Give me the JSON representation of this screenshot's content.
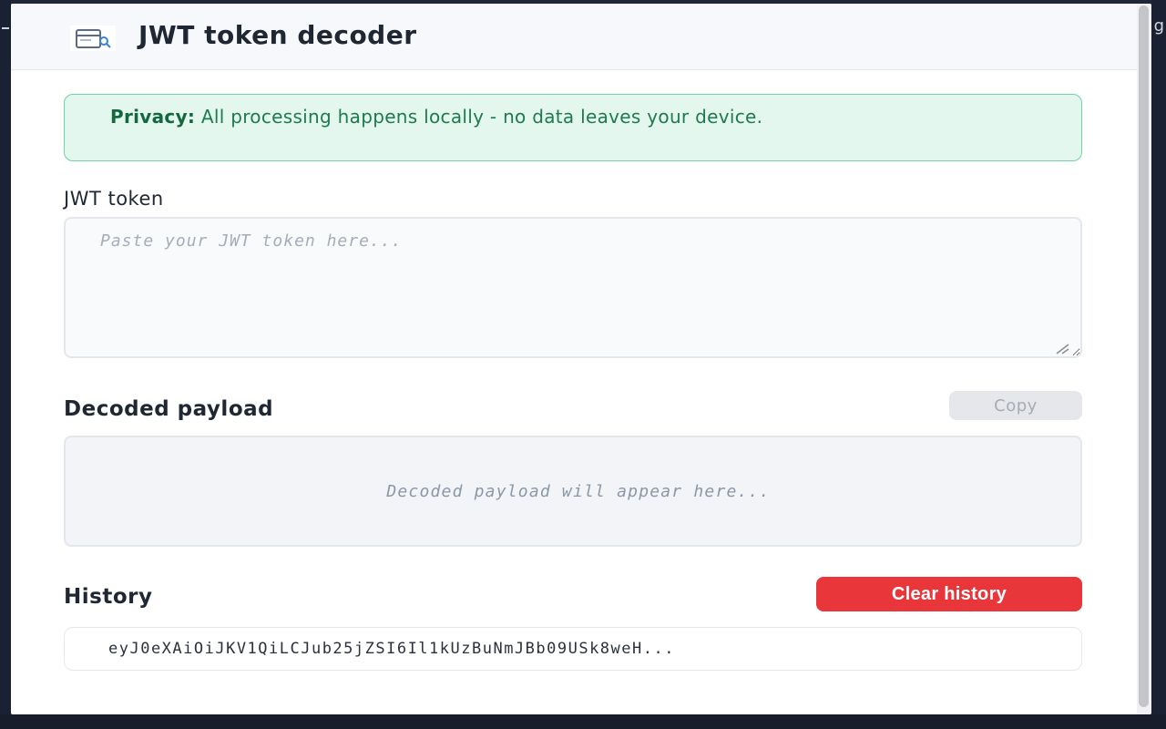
{
  "app": {
    "title": "JWT token decoder",
    "icon": "jwt-document-search-icon"
  },
  "privacy": {
    "label": "Privacy:",
    "message": "All processing happens locally - no data leaves your device."
  },
  "token": {
    "label": "JWT token",
    "placeholder": "Paste your JWT token here...",
    "value": ""
  },
  "payload": {
    "label": "Decoded payload",
    "copy_label": "Copy",
    "placeholder": "Decoded payload will appear here..."
  },
  "history": {
    "label": "History",
    "clear_label": "Clear history",
    "items": [
      {
        "text": "eyJ0eXAiOiJKV1QiLCJub25jZSI6Il1kUzBuNmJBb09USk8weH..."
      }
    ]
  },
  "background": {
    "edge_text": "g"
  },
  "colors": {
    "accent_danger": "#e8363a",
    "privacy_bg": "#e3f7ee",
    "privacy_border": "#6fd3a5",
    "privacy_text": "#1f7a4d"
  }
}
